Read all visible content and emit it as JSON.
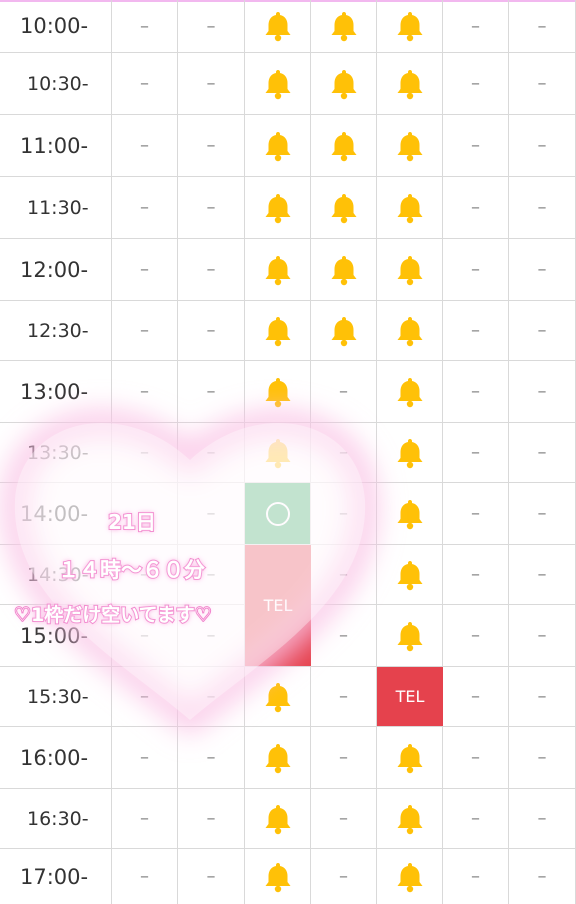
{
  "schedule": {
    "rows": [
      {
        "time": "10:00-",
        "cells": [
          "dash",
          "dash",
          "bell",
          "bell",
          "bell",
          "dash",
          "dash"
        ]
      },
      {
        "time": "10:30-",
        "cells": [
          "dash",
          "dash",
          "bell",
          "bell",
          "bell",
          "dash",
          "dash"
        ]
      },
      {
        "time": "11:00-",
        "cells": [
          "dash",
          "dash",
          "bell",
          "bell",
          "bell",
          "dash",
          "dash"
        ]
      },
      {
        "time": "11:30-",
        "cells": [
          "dash",
          "dash",
          "bell",
          "bell",
          "bell",
          "dash",
          "dash"
        ]
      },
      {
        "time": "12:00-",
        "cells": [
          "dash",
          "dash",
          "bell",
          "bell",
          "bell",
          "dash",
          "dash"
        ]
      },
      {
        "time": "12:30-",
        "cells": [
          "dash",
          "dash",
          "bell",
          "bell",
          "bell",
          "dash",
          "dash"
        ]
      },
      {
        "time": "13:00-",
        "cells": [
          "dash",
          "dash",
          "bell",
          "dash",
          "bell",
          "dash",
          "dash"
        ]
      },
      {
        "time": "13:30-",
        "cells": [
          "dash",
          "dash",
          "bell",
          "dash",
          "bell",
          "dash",
          "dash"
        ]
      },
      {
        "time": "14:00-",
        "cells": [
          "dash",
          "dash",
          "open",
          "dash",
          "bell",
          "dash",
          "dash"
        ]
      },
      {
        "time": "14:30-",
        "cells": [
          "dash",
          "dash",
          "tel",
          "dash",
          "bell",
          "dash",
          "dash"
        ]
      },
      {
        "time": "15:00-",
        "cells": [
          "dash",
          "dash",
          "tel",
          "dash",
          "bell",
          "dash",
          "dash"
        ]
      },
      {
        "time": "15:30-",
        "cells": [
          "dash",
          "dash",
          "bell",
          "dash",
          "tel",
          "dash",
          "dash"
        ]
      },
      {
        "time": "16:00-",
        "cells": [
          "dash",
          "dash",
          "bell",
          "dash",
          "bell",
          "dash",
          "dash"
        ]
      },
      {
        "time": "16:30-",
        "cells": [
          "dash",
          "dash",
          "bell",
          "dash",
          "bell",
          "dash",
          "dash"
        ]
      },
      {
        "time": "17:00-",
        "cells": [
          "dash",
          "dash",
          "bell",
          "dash",
          "bell",
          "dash",
          "dash"
        ]
      }
    ],
    "dash_symbol": "–",
    "tel_label": "TEL",
    "colors": {
      "bell": "#ffc107",
      "open": "#2eaa63",
      "tel": "#e5424d",
      "grid": "#d9d9d9",
      "overlay_accent": "#f07cc8"
    },
    "icons": {
      "bell": "bell-icon",
      "open": "circle-icon"
    }
  },
  "overlay": {
    "date": "21日",
    "hours": "１４時～６０分",
    "message": "♡1枠だけ空いてます♡"
  }
}
